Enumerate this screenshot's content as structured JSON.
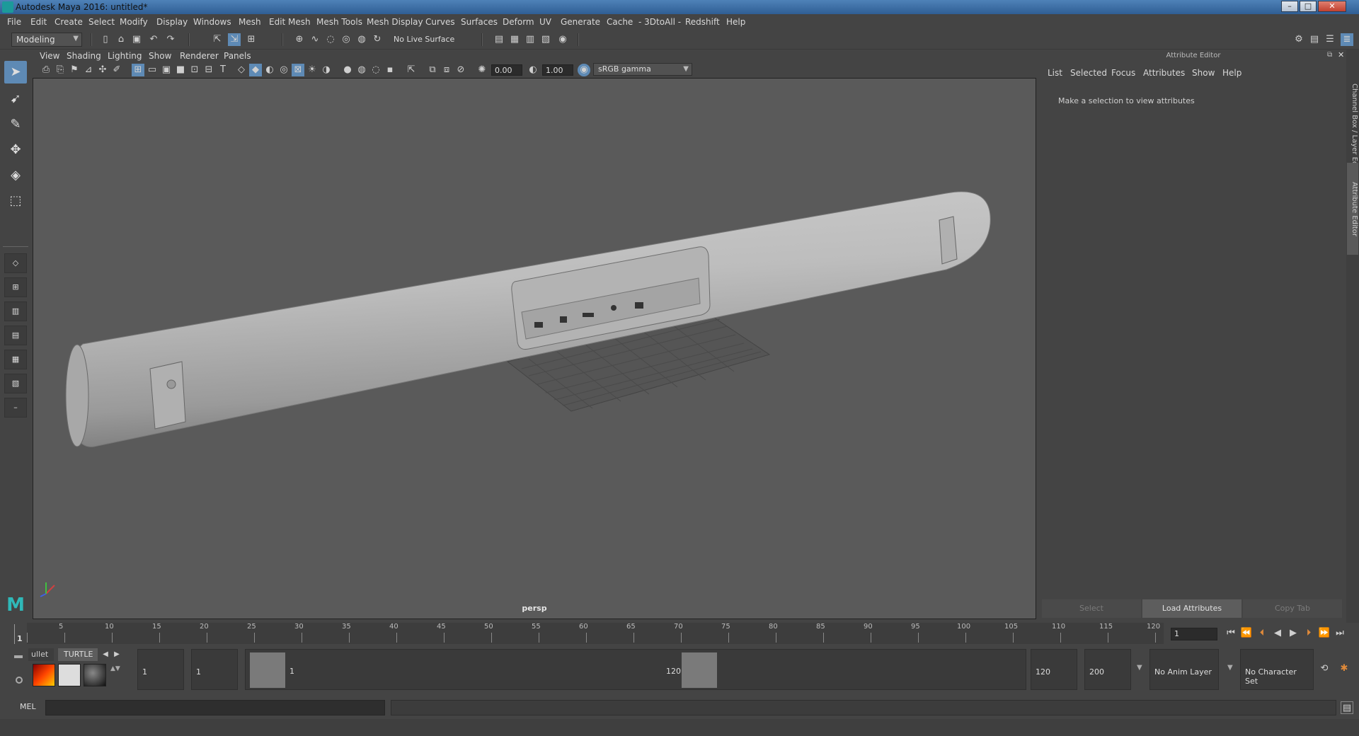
{
  "window": {
    "title": "Autodesk Maya 2016: untitled*"
  },
  "menubar": [
    "File",
    "Edit",
    "Create",
    "Select",
    "Modify",
    "Display",
    "Windows",
    "Mesh",
    "Edit Mesh",
    "Mesh Tools",
    "Mesh Display",
    "Curves",
    "Surfaces",
    "Deform",
    "UV",
    "Generate",
    "Cache",
    "- 3DtoAll -",
    "Redshift",
    "Help"
  ],
  "status": {
    "mode": "Modeling",
    "live_surface": "No Live Surface"
  },
  "panel": {
    "menus": [
      "View",
      "Shading",
      "Lighting",
      "Show",
      "Renderer",
      "Panels"
    ],
    "field1": "0.00",
    "field2": "1.00",
    "colorspace": "sRGB gamma",
    "camera": "persp"
  },
  "attribute_editor": {
    "header": "Attribute Editor",
    "menus": [
      "List",
      "Selected",
      "Focus",
      "Attributes",
      "Show",
      "Help"
    ],
    "message": "Make a selection to view attributes",
    "buttons": {
      "select": "Select",
      "load": "Load Attributes",
      "copy": "Copy Tab"
    },
    "side_tabs": {
      "channel_box": "Channel Box / Layer Editor",
      "attribute_editor": "Attribute Editor"
    }
  },
  "timeline": {
    "ticks": [
      "1",
      "5",
      "10",
      "15",
      "20",
      "25",
      "30",
      "35",
      "40",
      "45",
      "50",
      "55",
      "60",
      "65",
      "70",
      "75",
      "80",
      "85",
      "90",
      "95",
      "100",
      "105",
      "110",
      "115",
      "120"
    ],
    "current_frame": "1"
  },
  "shelf": {
    "tabs": [
      "ullet",
      "TURTLE"
    ]
  },
  "range": {
    "start": "1",
    "playback_start": "1",
    "inner_start": "1",
    "inner_end": "120",
    "playback_end": "120",
    "end": "200",
    "anim_layer": "No Anim Layer",
    "character_set": "No Character Set"
  },
  "command": {
    "label": "MEL"
  }
}
